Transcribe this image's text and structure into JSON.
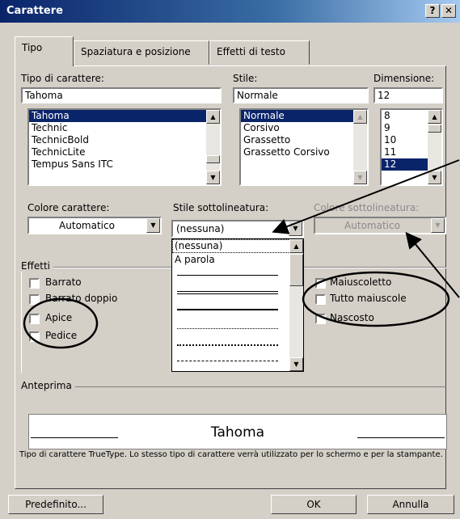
{
  "window": {
    "title": "Carattere",
    "help_label": "?",
    "close_label": "✕"
  },
  "tabs": [
    {
      "label": "Tipo",
      "active": true
    },
    {
      "label": "Spaziatura e posizione",
      "active": false
    },
    {
      "label": "Effetti di testo",
      "active": false
    }
  ],
  "font": {
    "label": "Tipo di carattere:",
    "value": "Tahoma",
    "items": [
      "Tahoma",
      "Technic",
      "TechnicBold",
      "TechnicLite",
      "Tempus Sans ITC"
    ],
    "selected": "Tahoma"
  },
  "style": {
    "label": "Stile:",
    "value": "Normale",
    "items": [
      "Normale",
      "Corsivo",
      "Grassetto",
      "Grassetto Corsivo"
    ],
    "selected": "Normale"
  },
  "size": {
    "label": "Dimensione:",
    "value": "12",
    "items": [
      "8",
      "9",
      "10",
      "11",
      "12"
    ],
    "selected": "12"
  },
  "font_color": {
    "label": "Colore carattere:",
    "value": "Automatico"
  },
  "underline_style": {
    "label": "Stile sottolineatura:",
    "value": "(nessuna)",
    "options": [
      "(nessuna)",
      "A parola"
    ],
    "line_styles": [
      "single",
      "double",
      "thick",
      "dotted",
      "dotted-thick",
      "dashed"
    ]
  },
  "underline_color": {
    "label": "Colore sottolineatura:",
    "value": "Automatico"
  },
  "effects": {
    "label": "Effetti",
    "left": [
      "Barrato",
      "Barrato doppio",
      "Apice",
      "Pedice"
    ],
    "right": [
      "Maiuscoletto",
      "Tutto maiuscole",
      "Nascosto"
    ]
  },
  "preview": {
    "label": "Anteprima",
    "text": "Tahoma",
    "note": "Tipo di carattere TrueType. Lo stesso tipo di carattere verrà utilizzato per lo schermo e per la stampante."
  },
  "buttons": {
    "default": "Predefinito...",
    "ok": "OK",
    "cancel": "Annulla"
  }
}
